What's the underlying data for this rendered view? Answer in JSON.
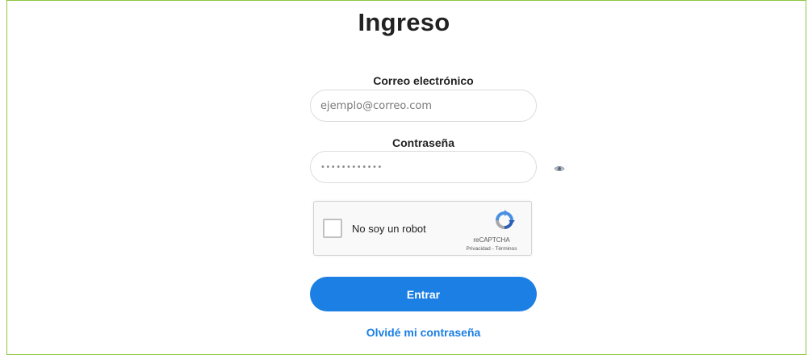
{
  "page": {
    "title": "Ingreso"
  },
  "form": {
    "email": {
      "label": "Correo electrónico",
      "placeholder": "ejemplo@correo.com",
      "value": ""
    },
    "password": {
      "label": "Contraseña",
      "value": "••••••••••••",
      "toggle_icon": "eye-icon"
    },
    "captcha": {
      "checkbox_label": "No soy un robot",
      "brand": "reCAPTCHA",
      "links": "Privacidad - Términos",
      "checked": false
    },
    "submit_label": "Entrar",
    "forgot_label": "Olvidé mi contraseña"
  },
  "colors": {
    "frame_border": "#8cc63f",
    "primary": "#1b7fe3"
  }
}
